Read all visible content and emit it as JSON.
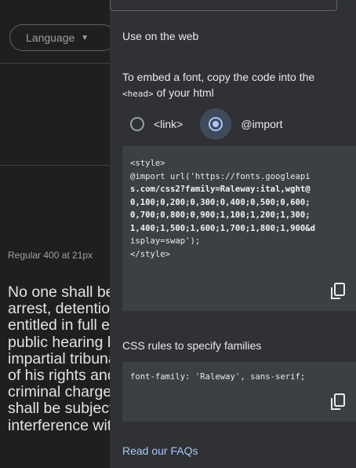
{
  "background_page": {
    "language_button": {
      "label": "Language"
    },
    "style_meta": "Regular 400 at 21px",
    "sample_lines": [
      "No one shall be subjected to arbitrary",
      "arrest, detention or exile. Everyone is",
      "entitled in full equality to a fair and",
      "public hearing by an independent and",
      "impartial tribunal, in the determination",
      "of his rights and obligations and of any",
      "criminal charge against him. No one",
      "shall be subjected to arbitrary",
      "interference with his privacy, family,"
    ]
  },
  "panel": {
    "title": "Use on the web",
    "embed_intro": "To embed a font, copy the code into the",
    "embed_code_word": "<head>",
    "embed_suffix": " of your html",
    "radio_link_label": "<link>",
    "radio_import_label": "@import",
    "selected_option": "@import",
    "code_lines": [
      "<style>",
      "@import url('https://fonts.googleapi",
      "s.com/css2?family=Raleway:ital,wght@",
      "0,100;0,200;0,300;0,400;0,500;0,600;",
      "0,700;0,800;0,900;1,100;1,200;1,300;",
      "1,400;1,500;1,600;1,700;1,800;1,900&d",
      "isplay=swap');",
      "</style>"
    ],
    "css_rules_title": "CSS rules to specify families",
    "css_rule": "font-family: 'Raleway', sans-serif;",
    "faq_link": "Read our FAQs"
  },
  "icons": {
    "language_caret": "chevron-down-icon",
    "copy_embed": "copy-icon",
    "copy_css": "copy-icon"
  },
  "colors": {
    "panel_bg": "#303134",
    "code_bg": "#3c4043",
    "accent": "#a8c7fa",
    "page_bg": "#1f1f1f"
  }
}
